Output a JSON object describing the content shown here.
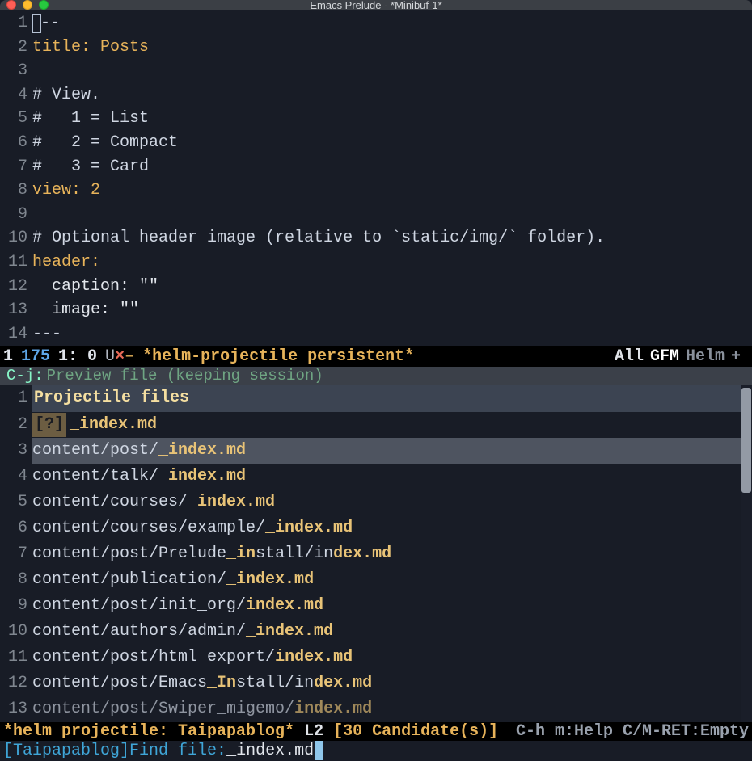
{
  "window": {
    "title": "Emacs Prelude -  *Minibuf-1*"
  },
  "colors": {
    "bg": "#181c26",
    "accent": "#e7b35a",
    "match": "#e8c377",
    "helm_key": "#87f5c7",
    "minibuf_prompt": "#3fa6d8"
  },
  "editor": {
    "lines": [
      {
        "n": 1,
        "type": "cursor_dashes",
        "text": "--"
      },
      {
        "n": 2,
        "type": "kv",
        "key": "title:",
        "val": " Posts"
      },
      {
        "n": 3,
        "type": "blank",
        "text": ""
      },
      {
        "n": 4,
        "type": "comment",
        "text": "# View."
      },
      {
        "n": 5,
        "type": "comment",
        "text": "#   1 = List"
      },
      {
        "n": 6,
        "type": "comment",
        "text": "#   2 = Compact"
      },
      {
        "n": 7,
        "type": "comment",
        "text": "#   3 = Card"
      },
      {
        "n": 8,
        "type": "kv",
        "key": "view:",
        "val": " 2"
      },
      {
        "n": 9,
        "type": "blank",
        "text": ""
      },
      {
        "n": 10,
        "type": "comment",
        "text": "# Optional header image (relative to `static/img/` folder)."
      },
      {
        "n": 11,
        "type": "key_only",
        "key": "header:"
      },
      {
        "n": 12,
        "type": "plain",
        "text": "  caption: \"\""
      },
      {
        "n": 13,
        "type": "plain",
        "text": "  image: \"\""
      },
      {
        "n": 14,
        "type": "dashes",
        "text": "---"
      }
    ]
  },
  "modeline1": {
    "pos1": "1",
    "pos_blue": "175",
    "col": "1: 0",
    "u": "U",
    "x": "×",
    "dash": "–",
    "buffer": "*helm-projectile persistent*",
    "all": "All",
    "gfm": "GFM",
    "helm": "Helm",
    "plus": "+"
  },
  "helm_header": {
    "key": "C-j:",
    "desc": "Preview file (keeping session)"
  },
  "helm_source_title": "Projectile files",
  "helm_items": [
    {
      "n": 2,
      "badge": "[?]",
      "prefix": "",
      "match": "_index.md",
      "suffix": ""
    },
    {
      "n": 3,
      "selected": true,
      "prefix": "content/post/",
      "match": "_index.md",
      "suffix": ""
    },
    {
      "n": 4,
      "prefix": "content/talk/",
      "match": "_index.md",
      "suffix": ""
    },
    {
      "n": 5,
      "prefix": "content/courses/",
      "match": "_index.md",
      "suffix": ""
    },
    {
      "n": 6,
      "prefix": "content/courses/example/",
      "match": "_index.md",
      "suffix": ""
    },
    {
      "n": 7,
      "prefix": "content/post/Prelude",
      "match_mid": "_in",
      "mid": "stall/in",
      "match": "dex.md",
      "suffix": ""
    },
    {
      "n": 8,
      "prefix": "content/publication/",
      "match": "_index.md",
      "suffix": ""
    },
    {
      "n": 9,
      "prefix": "content/post/init_org/",
      "match": "index.md",
      "suffix": ""
    },
    {
      "n": 10,
      "prefix": "content/authors/admin/",
      "match": "_index.md",
      "suffix": ""
    },
    {
      "n": 11,
      "prefix": "content/post/html_export/",
      "match": "index.md",
      "suffix": ""
    },
    {
      "n": 12,
      "prefix": "content/post/Emacs",
      "match_mid": "_In",
      "mid": "stall/in",
      "match": "dex.md",
      "suffix": ""
    },
    {
      "n": 13,
      "cutoff": true,
      "prefix": "content/post/Swiper_migemo/",
      "match": "index.md",
      "suffix": ""
    }
  ],
  "modeline2": {
    "name": "*helm projectile: Taipapablog*",
    "line": "L2",
    "candidates": "[30 Candidate(s)]",
    "help": "C-h m:Help C/M-RET:Empty"
  },
  "minibuffer": {
    "project": "[Taipapablog]",
    "prompt": " Find file: ",
    "input": "_index.md"
  }
}
